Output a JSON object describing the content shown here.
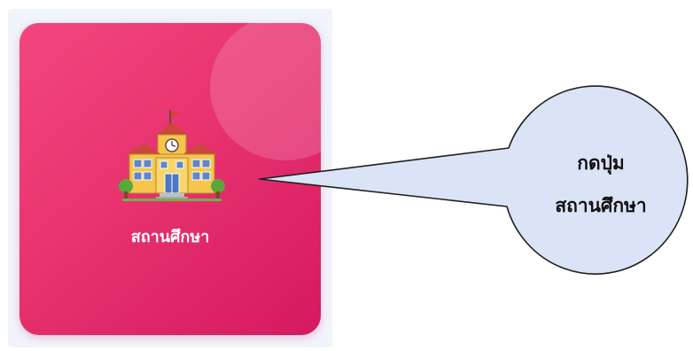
{
  "tile": {
    "label": "สถานศึกษา",
    "icon": "school-building-icon",
    "accent_start": "#f2467f",
    "accent_end": "#d51a5f"
  },
  "callout": {
    "line1": "กดปุ่ม",
    "line2": "สถานศึกษา",
    "fill": "#dbe4f6",
    "stroke": "#1f1f1f"
  }
}
